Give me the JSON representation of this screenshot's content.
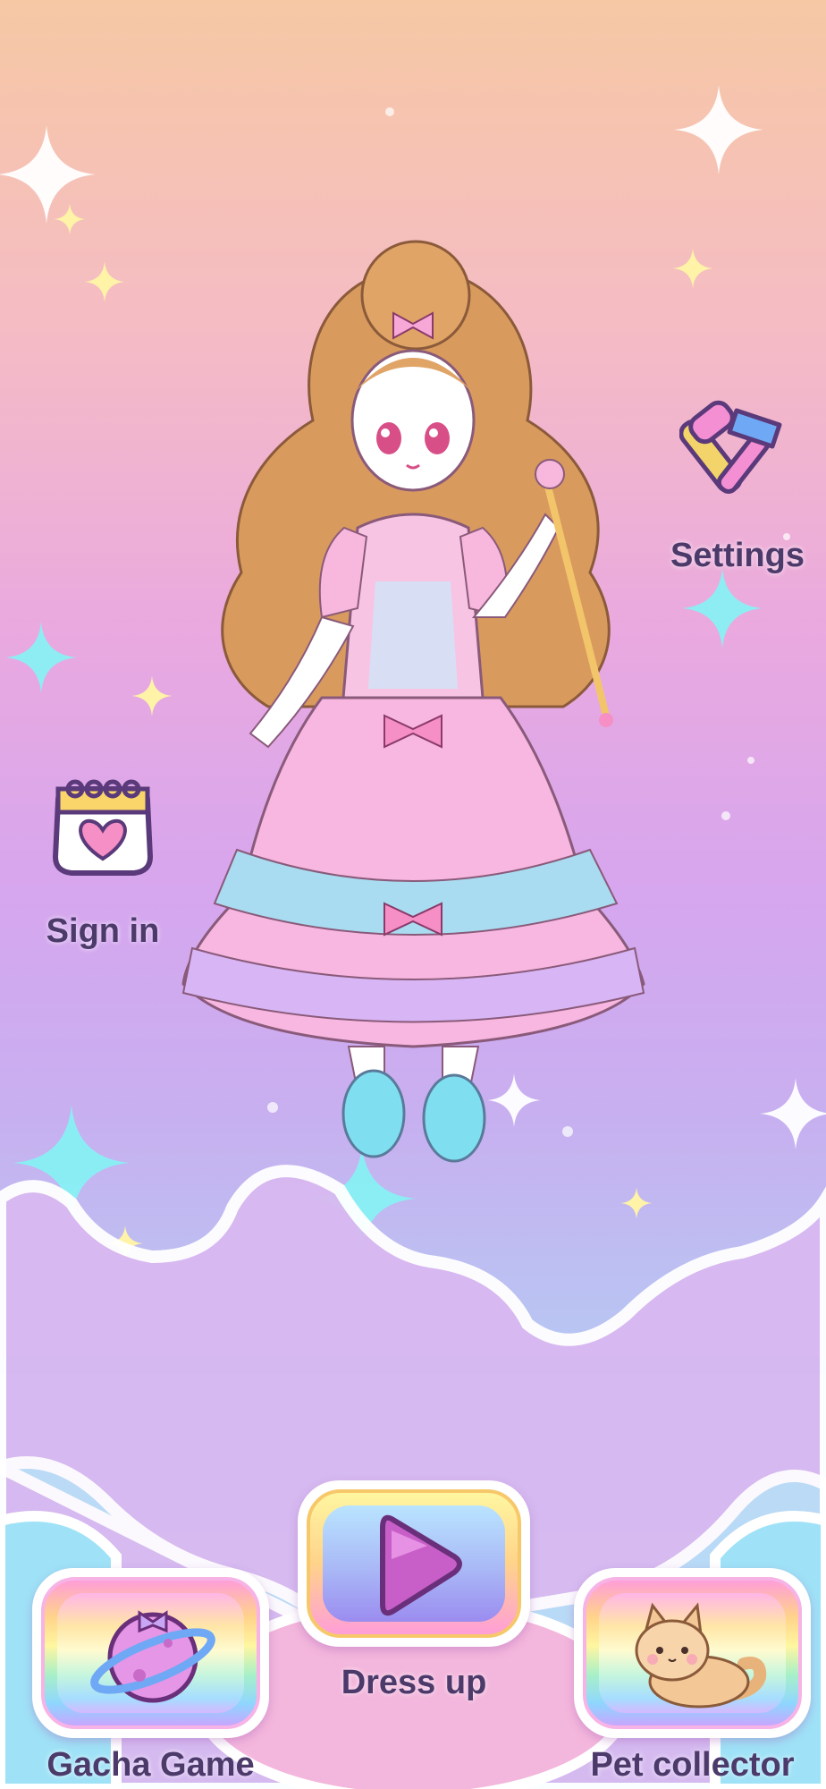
{
  "menu": {
    "settings_label": "Settings",
    "sign_in_label": "Sign in",
    "dress_up_label": "Dress up",
    "gacha_label": "Gacha Game",
    "pet_label": "Pet collector"
  },
  "icons": {
    "settings": "tools-icon",
    "sign_in": "calendar-heart-icon",
    "dress_up": "play-icon",
    "gacha": "planet-icon",
    "pet": "cat-icon"
  },
  "colors": {
    "label_text": "#4b3a6a",
    "accent_pink": "#f58fd3",
    "accent_blue": "#7fe6f2"
  }
}
